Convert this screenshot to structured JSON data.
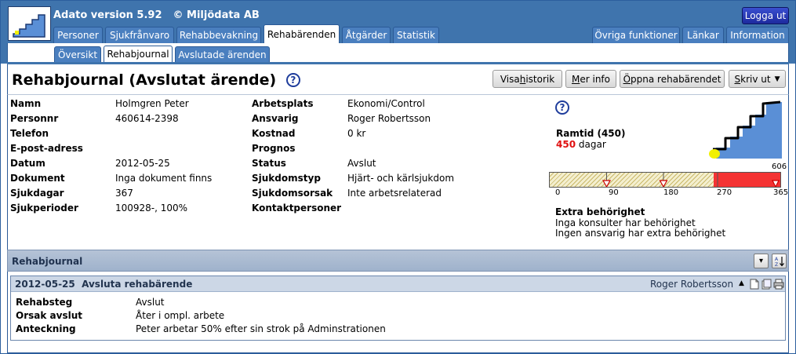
{
  "app": {
    "title": "Adato version 5.92",
    "copyright": "© Miljödata AB",
    "logout_label": "Logga ut"
  },
  "main_tabs": [
    {
      "label": "Personer",
      "active": false
    },
    {
      "label": "Sjukfrånvaro",
      "active": false
    },
    {
      "label": "Rehabbevakning",
      "active": false
    },
    {
      "label": "Rehabärenden",
      "active": true
    },
    {
      "label": "Åtgärder",
      "active": false
    },
    {
      "label": "Statistik",
      "active": false
    }
  ],
  "right_tabs": [
    {
      "label": "Övriga funktioner"
    },
    {
      "label": "Länkar"
    },
    {
      "label": "Information"
    }
  ],
  "sub_tabs": [
    {
      "label": "Översikt",
      "active": false
    },
    {
      "label": "Rehabjournal",
      "active": true
    },
    {
      "label": "Avslutade ärenden",
      "active": false
    }
  ],
  "page": {
    "title": "Rehabjournal (Avslutat ärende)",
    "help_glyph": "?"
  },
  "toolbar": {
    "history_label": "Visa historik",
    "info_label": "Mer info",
    "open_label": "Öppna rehabärendet",
    "print_label": "Skriv ut"
  },
  "left_fields": [
    {
      "label": "Namn",
      "value": "Holmgren Peter"
    },
    {
      "label": "Personnr",
      "value": "460614-2398"
    },
    {
      "label": "Telefon",
      "value": ""
    },
    {
      "label": "E-post-adress",
      "value": ""
    },
    {
      "label": "Datum",
      "value": "2012-05-25"
    },
    {
      "label": "Dokument",
      "value": "Inga dokument finns"
    },
    {
      "label": "Sjukdagar",
      "value": "367"
    },
    {
      "label": "Sjukperioder",
      "value": "100928-, 100%"
    }
  ],
  "mid_fields": [
    {
      "label": "Arbetsplats",
      "value": "Ekonomi/Control"
    },
    {
      "label": "Ansvarig",
      "value": "Roger Robertsson"
    },
    {
      "label": "Kostnad",
      "value": "0 kr"
    },
    {
      "label": "Prognos",
      "value": ""
    },
    {
      "label": "Status",
      "value": "Avslut"
    },
    {
      "label": "Sjukdomstyp",
      "value": "Hjärt- och kärlsjukdom"
    },
    {
      "label": "Sjukdomsorsak",
      "value": "Inte arbetsrelaterad"
    },
    {
      "label": "Kontaktpersoner",
      "value": ""
    }
  ],
  "ramtid": {
    "title": "Ramtid (450)",
    "days_value": "450",
    "days_unit": "dagar",
    "max_label": "606",
    "ticks": [
      "0",
      "90",
      "180",
      "270",
      "365"
    ],
    "red_fill_fraction": 0.29,
    "colors": {
      "red": "#f43333",
      "marker": "#cc0000",
      "steps": "#5a8fd6",
      "stairs": "#000000",
      "figure": "#f1f000"
    }
  },
  "extra": {
    "title": "Extra behörighet",
    "line1": "Inga konsulter har behörighet",
    "line2": "Ingen ansvarig har extra behörighet"
  },
  "journal": {
    "section_title": "Rehabjournal",
    "entry": {
      "date": "2012-05-25",
      "title": "Avsluta rehabärende",
      "author": "Roger Robertsson",
      "rows": [
        {
          "label": "Rehabsteg",
          "value": "Avslut"
        },
        {
          "label": "Orsak avslut",
          "value": "Åter i ompl. arbete"
        },
        {
          "label": "Anteckning",
          "value": "Peter arbetar 50% efter sin strok på Adminstrationen"
        }
      ]
    }
  }
}
